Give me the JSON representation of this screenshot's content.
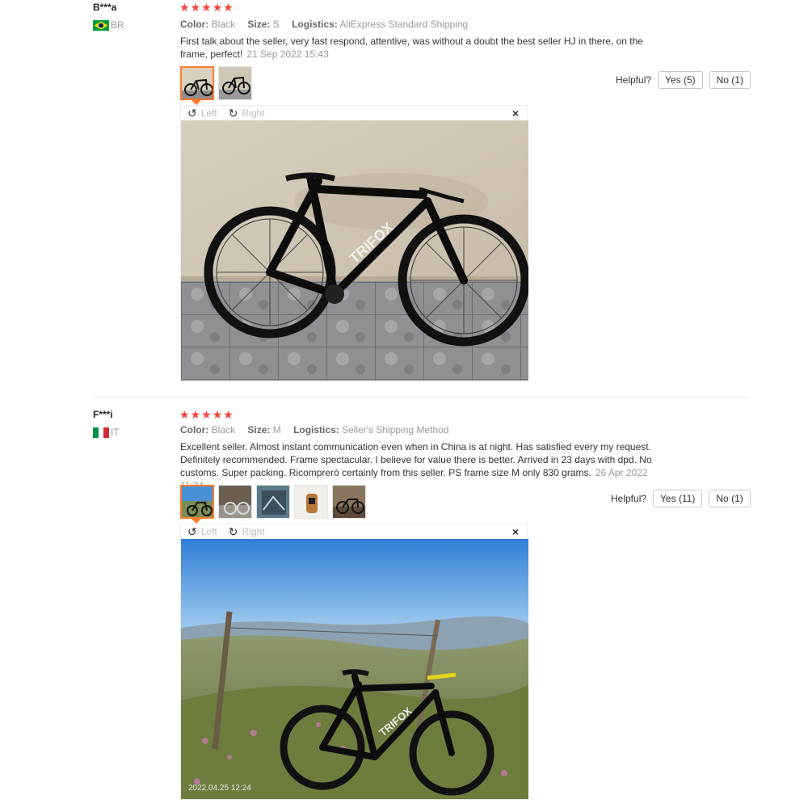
{
  "reviews": [
    {
      "user": "B***a",
      "country": "BR",
      "flag_colors": [
        "#009c3b",
        "#ffdf00",
        "#002776"
      ],
      "stars": 5,
      "star_char": "★",
      "color_label": "Color:",
      "color_value": "Black",
      "size_label": "Size:",
      "size_value": "S",
      "logistics_label": "Logistics:",
      "logistics_value": "AliExpress Standard Shipping",
      "text": "First talk about the seller, very fast respond, attentive, was without a doubt the best seller HJ in there, on the frame, perfect!",
      "date": "21 Sep 2022 15:43",
      "thumb_count": 2,
      "helpful_label": "Helpful?",
      "yes_label": "Yes (5)",
      "no_label": "No (1)",
      "viewer": {
        "left_label": "Left",
        "right_label": "Right",
        "close_icon": "×"
      }
    },
    {
      "user": "F***i",
      "country": "IT",
      "flag_colors": [
        "#009246",
        "#ffffff",
        "#ce2b37"
      ],
      "stars": 5,
      "star_char": "★",
      "color_label": "Color:",
      "color_value": "Black",
      "size_label": "Size:",
      "size_value": "M",
      "logistics_label": "Logistics:",
      "logistics_value": "Seller's Shipping Method",
      "text": "Excellent seller. Almost instant communication even when in China is at night. Has satisfied every my request. Definitely recommended. Frame spectacular. I believe for value there is better. Arrived in 23 days with dpd. No customs. Super packing. Ricomprerò certainly from this seller. PS frame size M only 830 grams.",
      "date": "26 Apr 2022 11:24",
      "thumb_count": 5,
      "helpful_label": "Helpful?",
      "yes_label": "Yes (11)",
      "no_label": "No (1)",
      "viewer": {
        "left_label": "Left",
        "right_label": "Right",
        "close_icon": "×"
      },
      "photo_stamp": "2022.04.25 12:24"
    }
  ],
  "accent_color": "#ff7a28",
  "star_color": "#f44336"
}
